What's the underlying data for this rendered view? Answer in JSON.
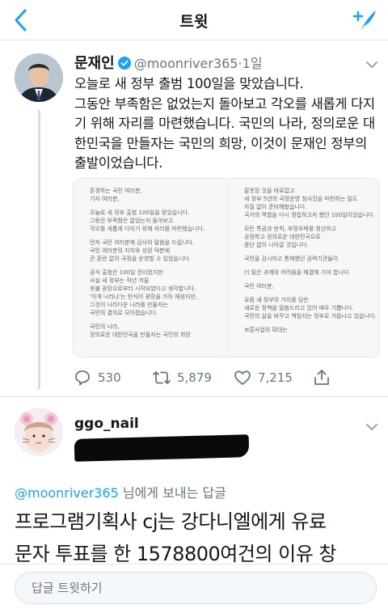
{
  "nav": {
    "title": "트윗",
    "back_icon": "chevron-left-icon",
    "compose_icon": "compose-tweet-icon",
    "accent": "#1da1f2"
  },
  "tweet": {
    "author_name": "문재인",
    "handle": "@moonriver365",
    "dot": "·",
    "time": "1일",
    "text": "오늘로 새 정부 출범 100일을 맞았습니다.\n그동안 부족함은 없었는지 돌아보고 각오를 새롭게 다지기 위해 자리를 마련했습니다. 국민의 나라, 정의로운 대한민국을 만들자는 국민의 희망, 이것이 문재인 정부의 출발이었습니다.",
    "image_left_lines": [
      "존경하는 국민 여러분,",
      "기자 여러분,",
      "",
      "오늘로 새 정부 출범 100일을 맞았습니다.",
      "그동안 부족함은 없었는지 돌아보고",
      "각오를 새롭게 다지기 위해 자리를 마련했습니다.",
      "",
      "먼저 국민 여러분께 감사의 말씀을 드립니다.",
      "국민 여러분의 지지와 성원 덕분에",
      "큰 혼란 없이 국정을 운영할 수 있었습니다.",
      "",
      "공식 출범은 100일 전이었지만",
      "사실 새 정부는 작년 겨울",
      "촛불 광장으로부터 시작되었다고 생각합니다.",
      "'이게 나라냐'는 탄식이 광장을 가득 채웠지만,",
      "그것이 나라다운 나라를 만들자는",
      "국민의 결의로 모아졌습니다.",
      "",
      "국민의 나라,",
      "정의로운 대한민국을 만들자는 국민의 희망"
    ],
    "image_right_lines": [
      "잘못된 것을 바로잡고",
      "새 정부 5년의 국정운영 청사진을 마련하는 일도",
      "차질 없이 준비해왔습니다.",
      "국가의 역할을 다시 정립하고자 했던 100일이었습니다.",
      "",
      "모든 특권과 반칙, 부정부패를 청산하고",
      "공정하고 정의로운 대한민국으로",
      "중단 없이 나아갈 것입니다.",
      "",
      "국민을 감시하고 통제했던 권력기관들이",
      "",
      "더 많은 과제와 어려움을 해결해 가야 합니다.",
      "",
      "국민 여러분,",
      "",
      "요즘 새 정부의 가치를 담은",
      "새로운 정책을 말씀드리고 있어 매우 기쁩니다.",
      "국민의 삶을 바꾸고 책임지는 정부로 거듭나고 있습니다.",
      "",
      "보훈사업의 확대는"
    ],
    "replies_count": "530",
    "retweets_count": "5,879",
    "likes_count": "7,215"
  },
  "reply": {
    "author_name": "ggo_nail",
    "mention": "@moonriver365",
    "reply_suffix": " 님에게 보내는 답글",
    "text": "프로그램기획사 cj는 강다니엘에게 유료\n문자 투표를 한 1578800여건의 이유 창"
  },
  "reply_bar": {
    "placeholder": "답글 트윗하기"
  }
}
